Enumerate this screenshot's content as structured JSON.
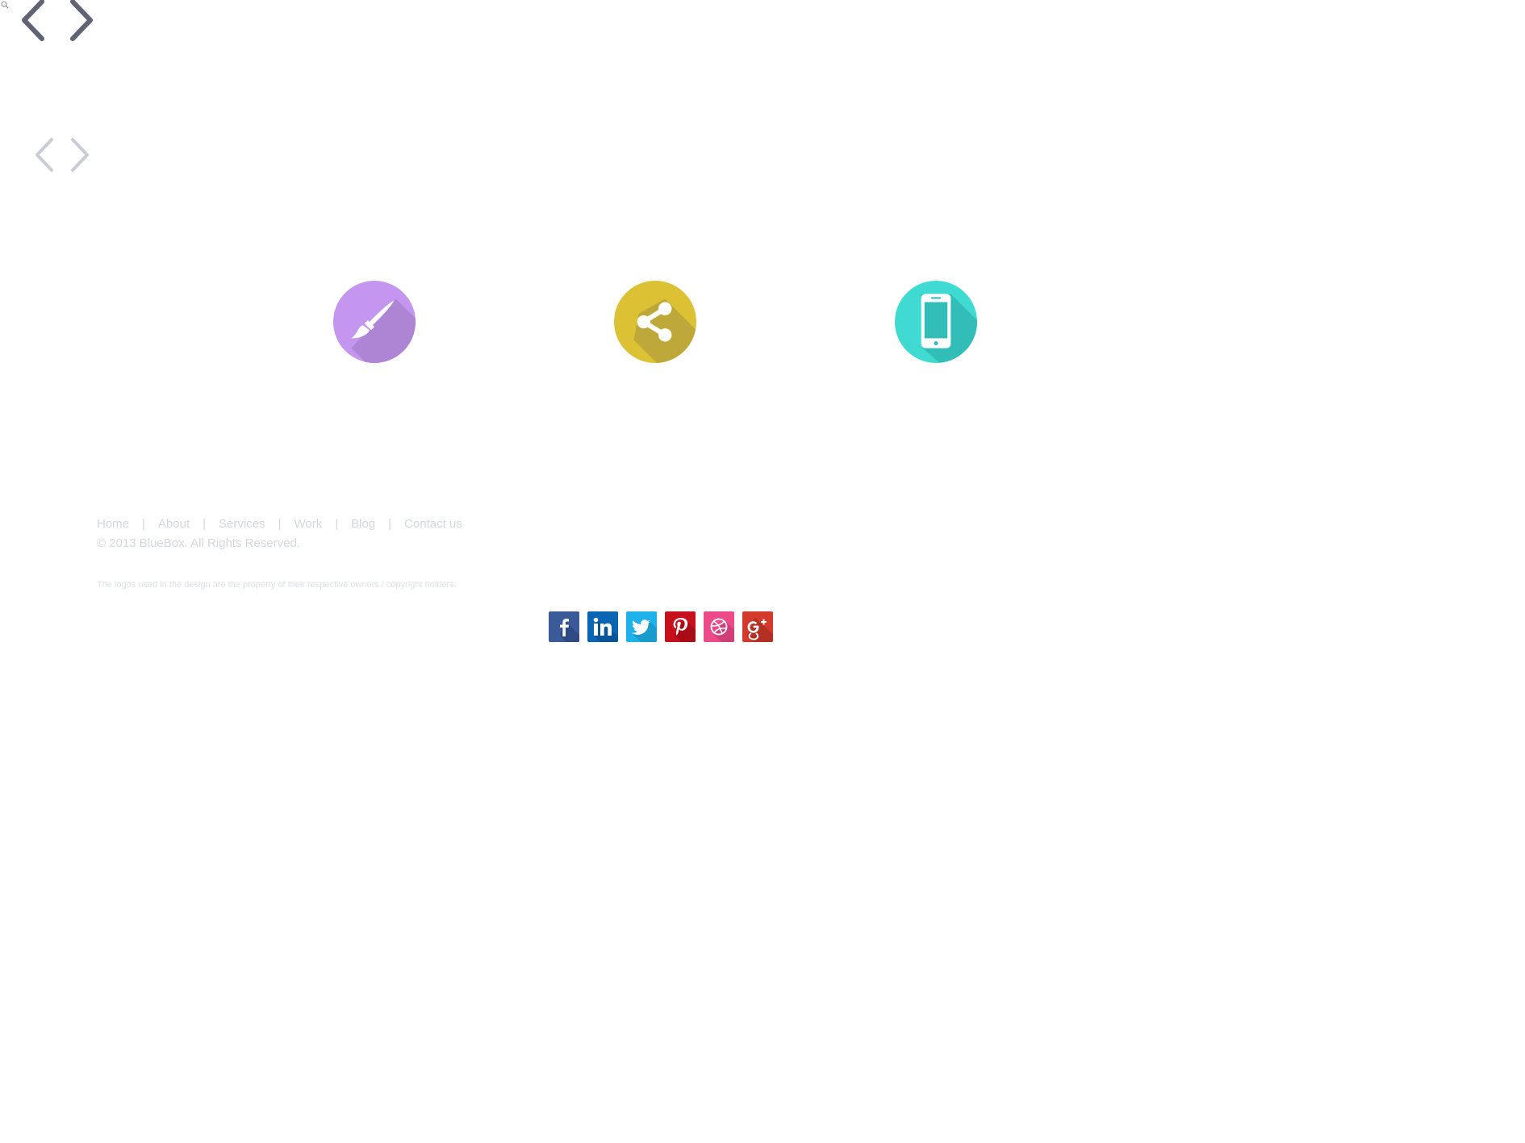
{
  "nav_arrows": {
    "large": [
      "chevron-left-icon",
      "chevron-right-icon"
    ],
    "small": [
      "chevron-left-icon",
      "chevron-right-icon"
    ],
    "large_color": "#5f6373",
    "small_color": "#c9ccd6"
  },
  "services": [
    {
      "icon": "paintbrush-icon",
      "color": "#c596f0",
      "shadow": "#ae84d4"
    },
    {
      "icon": "share-icon",
      "color": "#dcc135",
      "shadow": "#bea83a"
    },
    {
      "icon": "smartphone-icon",
      "color": "#3fdbd3",
      "shadow": "#33bdb8"
    }
  ],
  "footer": {
    "nav": [
      {
        "label": "Home"
      },
      {
        "label": "About"
      },
      {
        "label": "Services"
      },
      {
        "label": "Work"
      },
      {
        "label": "Blog"
      },
      {
        "label": "Contact us"
      }
    ],
    "separator": "|",
    "copyright": "© 2013 BlueBox. All Rights Reserved.",
    "disclaimer": "The logos used in the design are the property of their respective owners / copyright holders."
  },
  "social": [
    {
      "icon": "facebook-icon",
      "color": "#3b5a9a"
    },
    {
      "icon": "linkedin-icon",
      "color": "#0a66b5"
    },
    {
      "icon": "twitter-icon",
      "color": "#1fb1ea"
    },
    {
      "icon": "pinterest-icon",
      "color": "#c8101c"
    },
    {
      "icon": "dribbble-icon",
      "color": "#ec4a89"
    },
    {
      "icon": "google-plus-icon",
      "color": "#d33a2b"
    }
  ]
}
